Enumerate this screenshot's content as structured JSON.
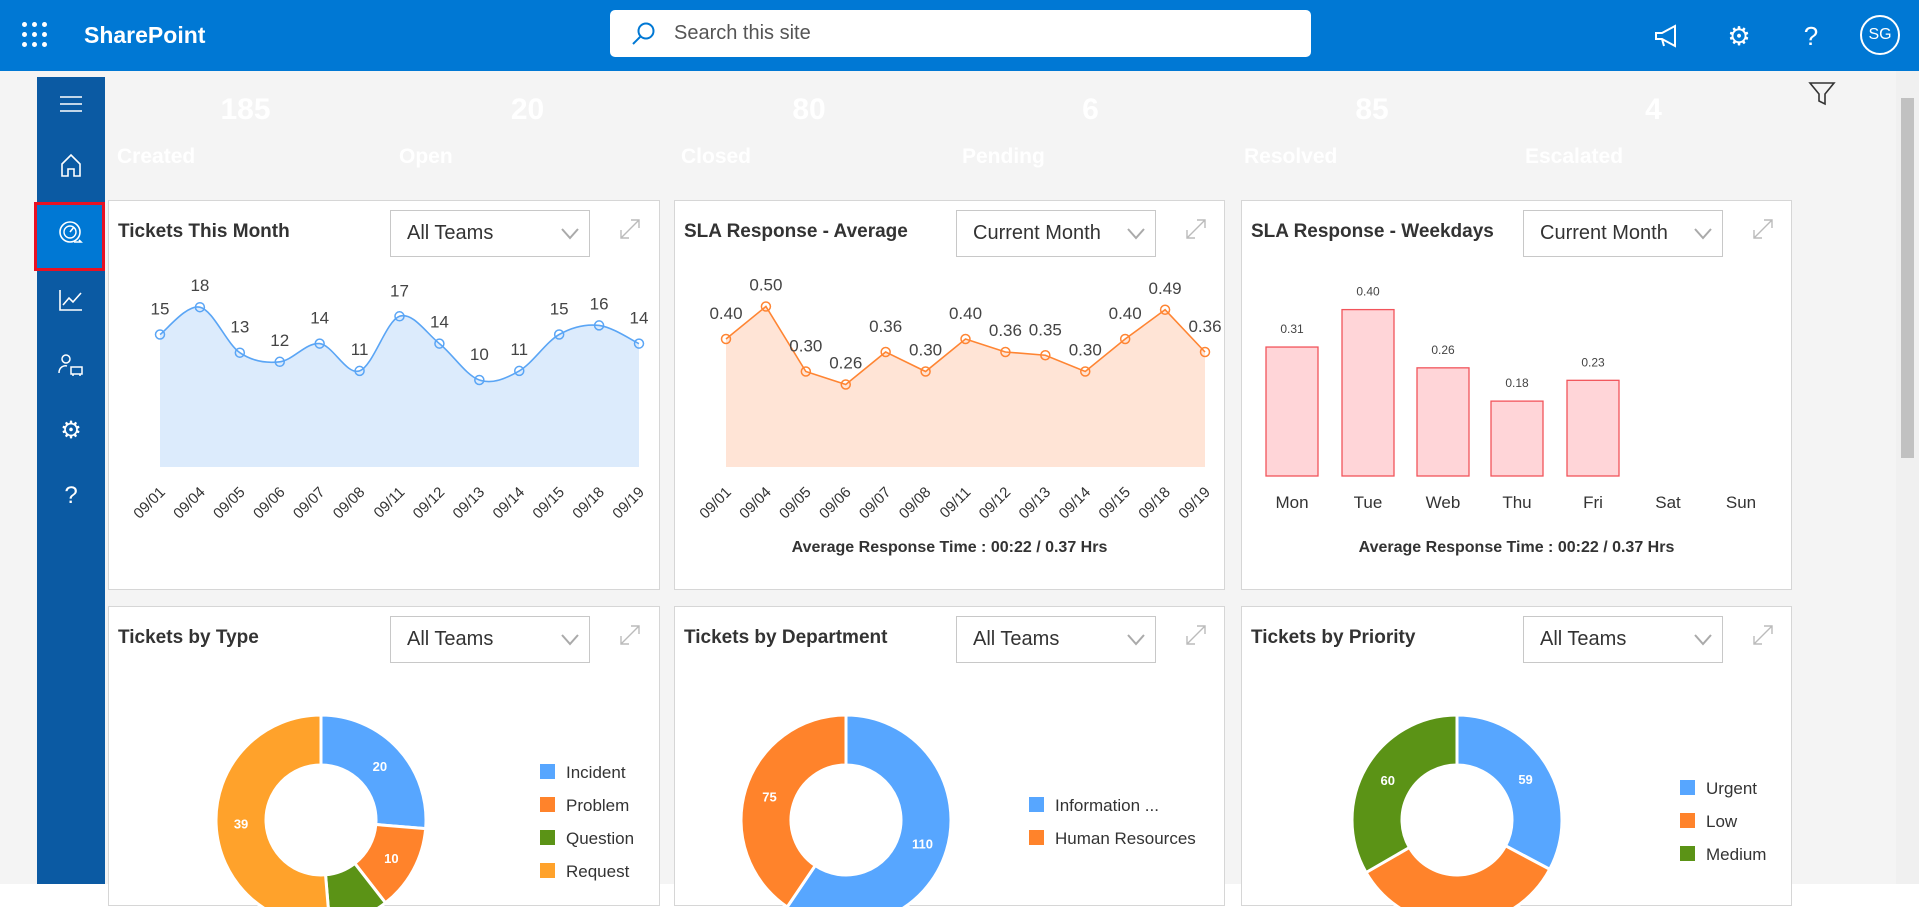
{
  "header": {
    "app_name": "SharePoint",
    "search_placeholder": "Search this site",
    "avatar_initials": "SG"
  },
  "kpis": [
    {
      "value": "185",
      "label": "Created",
      "color": "#57a6ff"
    },
    {
      "value": "20",
      "label": "Open",
      "color": "#ff832b"
    },
    {
      "value": "80",
      "label": "Closed",
      "color": "#5b9316"
    },
    {
      "value": "6",
      "label": "Pending",
      "color": "#ffa22b"
    },
    {
      "value": "85",
      "label": "Resolved",
      "color": "#3cc230"
    },
    {
      "value": "4",
      "label": "Escalated",
      "color": "#ff2e2e"
    }
  ],
  "cards": [
    {
      "title": "Tickets This Month",
      "filter": "All Teams"
    },
    {
      "title": "SLA Response - Average",
      "filter": "Current Month",
      "footer": "Average Response Time : 00:22 / 0.37 Hrs"
    },
    {
      "title": "SLA Response - Weekdays",
      "filter": "Current Month",
      "footer": "Average Response Time : 00:22 / 0.37 Hrs"
    },
    {
      "title": "Tickets by Type",
      "filter": "All Teams"
    },
    {
      "title": "Tickets by Department",
      "filter": "All Teams"
    },
    {
      "title": "Tickets by Priority",
      "filter": "All Teams"
    }
  ],
  "chart_data": [
    {
      "type": "area",
      "smooth": true,
      "categories": [
        "09/01",
        "09/04",
        "09/05",
        "09/06",
        "09/07",
        "09/08",
        "09/11",
        "09/12",
        "09/13",
        "09/14",
        "09/15",
        "09/18",
        "09/19"
      ],
      "values": [
        15,
        18,
        13,
        12,
        14,
        11,
        17,
        14,
        10,
        11,
        15,
        16,
        14
      ],
      "color": "#5aa5f5",
      "fill": "#dcebfc"
    },
    {
      "type": "area",
      "categories": [
        "09/01",
        "09/04",
        "09/05",
        "09/06",
        "09/07",
        "09/08",
        "09/11",
        "09/12",
        "09/13",
        "09/14",
        "09/15",
        "09/18",
        "09/19"
      ],
      "values": [
        0.4,
        0.5,
        0.3,
        0.26,
        0.36,
        0.3,
        0.4,
        0.36,
        0.35,
        0.3,
        0.4,
        0.49,
        0.36
      ],
      "labels": [
        "0.40",
        "0.50",
        "0.30",
        "0.26",
        "0.36",
        "0.30",
        "0.40",
        "0.36",
        "0.35",
        "0.30",
        "0.40",
        "0.49",
        "0.36"
      ],
      "color": "#ff8533",
      "fill": "#ffe4d6"
    },
    {
      "type": "bar",
      "categories": [
        "Mon",
        "Tue",
        "Web",
        "Thu",
        "Fri",
        "Sat",
        "Sun"
      ],
      "values": [
        0.31,
        0.4,
        0.26,
        0.18,
        0.23,
        null,
        null
      ],
      "labels": [
        "0.31",
        "0.40",
        "0.26",
        "0.18",
        "0.23",
        "",
        ""
      ],
      "color": "#f2545b",
      "fill": "#ffd5d8"
    },
    {
      "type": "pie",
      "donut": true,
      "categories": [
        "Incident",
        "Problem",
        "Question",
        "Request"
      ],
      "values": [
        20,
        10,
        7,
        39
      ],
      "labels": [
        "20",
        "10",
        "",
        "39"
      ],
      "colors": [
        "#57a6ff",
        "#ff832b",
        "#5b9316",
        "#ffa22b"
      ]
    },
    {
      "type": "pie",
      "donut": true,
      "categories": [
        "Information ...",
        "Human Resources"
      ],
      "values": [
        110,
        75
      ],
      "labels": [
        "110",
        "75"
      ],
      "colors": [
        "#57a6ff",
        "#ff832b"
      ]
    },
    {
      "type": "pie",
      "donut": true,
      "categories": [
        "Urgent",
        "Low",
        "Medium"
      ],
      "values": [
        59,
        61,
        60
      ],
      "labels": [
        "59",
        "",
        "60"
      ],
      "colors": [
        "#57a6ff",
        "#ff832b",
        "#5b9316"
      ]
    }
  ]
}
